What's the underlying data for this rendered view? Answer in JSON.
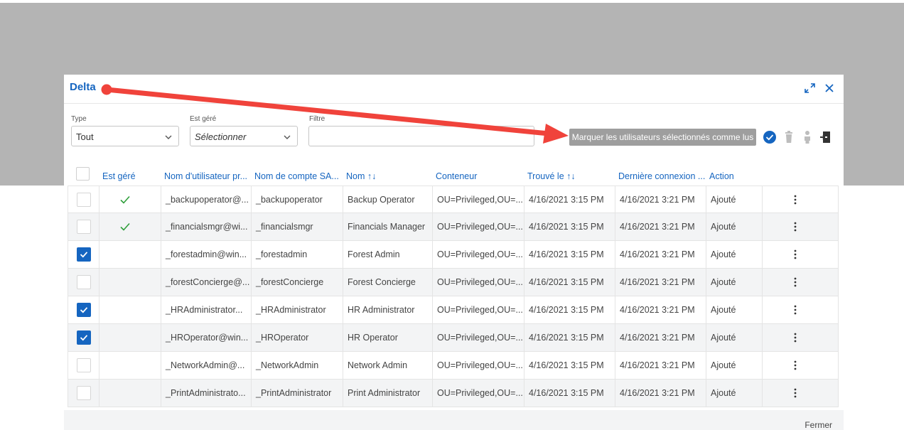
{
  "dialog": {
    "title": "Delta",
    "expand_icon": "expand-icon",
    "close_icon": "close-icon"
  },
  "filters": {
    "type_label": "Type",
    "type_value": "Tout",
    "managed_label": "Est géré",
    "managed_placeholder": "Sélectionner",
    "filter_label": "Filtre",
    "filter_value": ""
  },
  "toolbar": {
    "tooltip": "Marquer les utilisateurs sélectionnés comme lus",
    "icons": [
      "check-circle-icon",
      "trash-icon",
      "user-icon",
      "export-icon"
    ]
  },
  "table": {
    "columns": [
      "Est géré",
      "Nom d'utilisateur pr...",
      "Nom de compte SA...",
      "Nom ↑↓",
      "Conteneur",
      "Trouvé le ↑↓",
      "Dernière connexion ...",
      "Action"
    ],
    "rows": [
      {
        "checked": false,
        "managed": true,
        "upn": "_backupoperator@...",
        "sam": "_backupoperator",
        "name": "Backup Operator",
        "container": "OU=Privileged,OU=...",
        "found": "4/16/2021 3:15 PM",
        "last_login": "4/16/2021 3:21 PM",
        "action": "Ajouté"
      },
      {
        "checked": false,
        "managed": true,
        "upn": "_financialsmgr@wi...",
        "sam": "_financialsmgr",
        "name": "Financials Manager",
        "container": "OU=Privileged,OU=...",
        "found": "4/16/2021 3:15 PM",
        "last_login": "4/16/2021 3:21 PM",
        "action": "Ajouté"
      },
      {
        "checked": true,
        "managed": false,
        "upn": "_forestadmin@win...",
        "sam": "_forestadmin",
        "name": "Forest Admin",
        "container": "OU=Privileged,OU=...",
        "found": "4/16/2021 3:15 PM",
        "last_login": "4/16/2021 3:21 PM",
        "action": "Ajouté"
      },
      {
        "checked": false,
        "managed": false,
        "upn": "_forestConcierge@...",
        "sam": "_forestConcierge",
        "name": "Forest Concierge",
        "container": "OU=Privileged,OU=...",
        "found": "4/16/2021 3:15 PM",
        "last_login": "4/16/2021 3:21 PM",
        "action": "Ajouté"
      },
      {
        "checked": true,
        "managed": false,
        "upn": "_HRAdministrator...",
        "sam": "_HRAdministrator",
        "name": "HR Administrator",
        "container": "OU=Privileged,OU=...",
        "found": "4/16/2021 3:15 PM",
        "last_login": "4/16/2021 3:21 PM",
        "action": "Ajouté"
      },
      {
        "checked": true,
        "managed": false,
        "upn": "_HROperator@win...",
        "sam": "_HROperator",
        "name": "HR Operator",
        "container": "OU=Privileged,OU=...",
        "found": "4/16/2021 3:15 PM",
        "last_login": "4/16/2021 3:21 PM",
        "action": "Ajouté"
      },
      {
        "checked": false,
        "managed": false,
        "upn": "_NetworkAdmin@...",
        "sam": "_NetworkAdmin",
        "name": "Network Admin",
        "container": "OU=Privileged,OU=...",
        "found": "4/16/2021 3:15 PM",
        "last_login": "4/16/2021 3:21 PM",
        "action": "Ajouté"
      },
      {
        "checked": false,
        "managed": false,
        "upn": "_PrintAdministrato...",
        "sam": "_PrintAdministrator",
        "name": "Print Administrator",
        "container": "OU=Privileged,OU=...",
        "found": "4/16/2021 3:15 PM",
        "last_login": "4/16/2021 3:21 PM",
        "action": "Ajouté"
      }
    ]
  },
  "footer": {
    "close_label": "Fermer"
  },
  "colors": {
    "accent": "#1565c0",
    "annotation_arrow": "#f0433b",
    "success_check": "#2e9e3a"
  }
}
